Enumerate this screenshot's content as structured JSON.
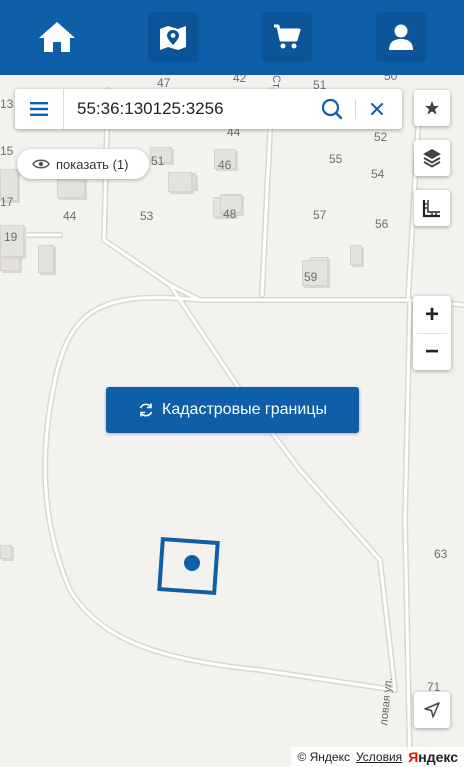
{
  "nav": {
    "items": [
      {
        "name": "home-icon"
      },
      {
        "name": "map-marker-icon"
      },
      {
        "name": "cart-icon"
      },
      {
        "name": "user-icon"
      }
    ],
    "color": "#0f5ea8"
  },
  "search": {
    "value": "55:36:130125:3256",
    "placeholder": ""
  },
  "show_button": {
    "label": "показать (1)"
  },
  "cadastral_button": {
    "label": "Кадастровые границы"
  },
  "zoom": {
    "plus": "+",
    "minus": "−"
  },
  "house_numbers": [
    "13",
    "47",
    "42",
    "51",
    "50",
    "44",
    "52",
    "15",
    "51",
    "46",
    "55",
    "54",
    "17",
    "44",
    "53",
    "48",
    "57",
    "56",
    "19",
    "59",
    "63",
    "71"
  ],
  "street_label": "ловая ул.",
  "street_label_top": "Ст",
  "footer": {
    "copyright": "© Яндекс",
    "terms": "Условия",
    "logo_a": "Я",
    "logo_b": "ндекс"
  }
}
